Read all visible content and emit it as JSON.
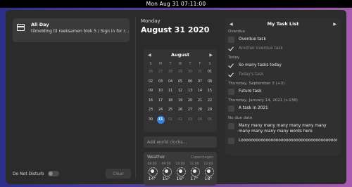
{
  "topbar": {
    "clock": "Mon Aug 31  07:11:00"
  },
  "notification": {
    "title": "All Day",
    "body": "tilmelding til reeksamen blok 5 / Sign in for re-exam…",
    "icon": "calendar-icon"
  },
  "footer": {
    "dnd_label": "Do Not Disturb",
    "clear_label": "Clear"
  },
  "date": {
    "day": "Monday",
    "full": "August 31 2020"
  },
  "calendar": {
    "month": "August",
    "weekdays": [
      "S",
      "M",
      "T",
      "W",
      "T",
      "F",
      "S"
    ],
    "weeks": [
      [
        "26",
        "27",
        "28",
        "29",
        "30",
        "31",
        "01"
      ],
      [
        "02",
        "03",
        "04",
        "05",
        "06",
        "07",
        "08"
      ],
      [
        "09",
        "10",
        "11",
        "12",
        "13",
        "14",
        "15"
      ],
      [
        "16",
        "17",
        "18",
        "19",
        "20",
        "21",
        "22"
      ],
      [
        "23",
        "24",
        "25",
        "26",
        "27",
        "28",
        "29"
      ],
      [
        "30",
        "31",
        "01",
        "02",
        "03",
        "04",
        "05"
      ]
    ],
    "today": "31"
  },
  "world_clocks": {
    "placeholder": "Add world clocks…"
  },
  "weather": {
    "title": "Weather",
    "location": "Copenhagen",
    "forecast": [
      {
        "time": "08:00",
        "temp": "14°",
        "icon": "sun-icon"
      },
      {
        "time": "09:00",
        "temp": "15°",
        "icon": "sun-icon"
      },
      {
        "time": "10:00",
        "temp": "16°",
        "icon": "sun-icon"
      },
      {
        "time": "11:00",
        "temp": "17°",
        "icon": "sun-icon"
      },
      {
        "time": "12:00",
        "temp": "18°",
        "icon": "sun-icon"
      }
    ]
  },
  "tasks": {
    "title": "My Task List",
    "sections": [
      {
        "label": "Overdue"
      },
      {
        "label": "Today"
      },
      {
        "label": "Thursday, September 3 (+3)"
      },
      {
        "label": "Thursday, January 14, 2021 (+136)"
      },
      {
        "label": "No due date"
      }
    ],
    "items": [
      {
        "text": "Overdue task",
        "done": false
      },
      {
        "text": "Another overdue task",
        "done": true
      },
      {
        "text": "So many tasks today",
        "done": true
      },
      {
        "text": "Today's task",
        "done": true
      },
      {
        "text": "Future task",
        "done": false
      },
      {
        "text": "A task in 2021",
        "done": false
      },
      {
        "text": "Many many many many many many many many many many many words  here",
        "done": false
      },
      {
        "text": "Looooooooooooooooooooooooooooooooooooooooooooooooooooog",
        "done": false
      }
    ]
  },
  "colors": {
    "accent": "#3584e4",
    "panel": "#2b2b2b"
  }
}
